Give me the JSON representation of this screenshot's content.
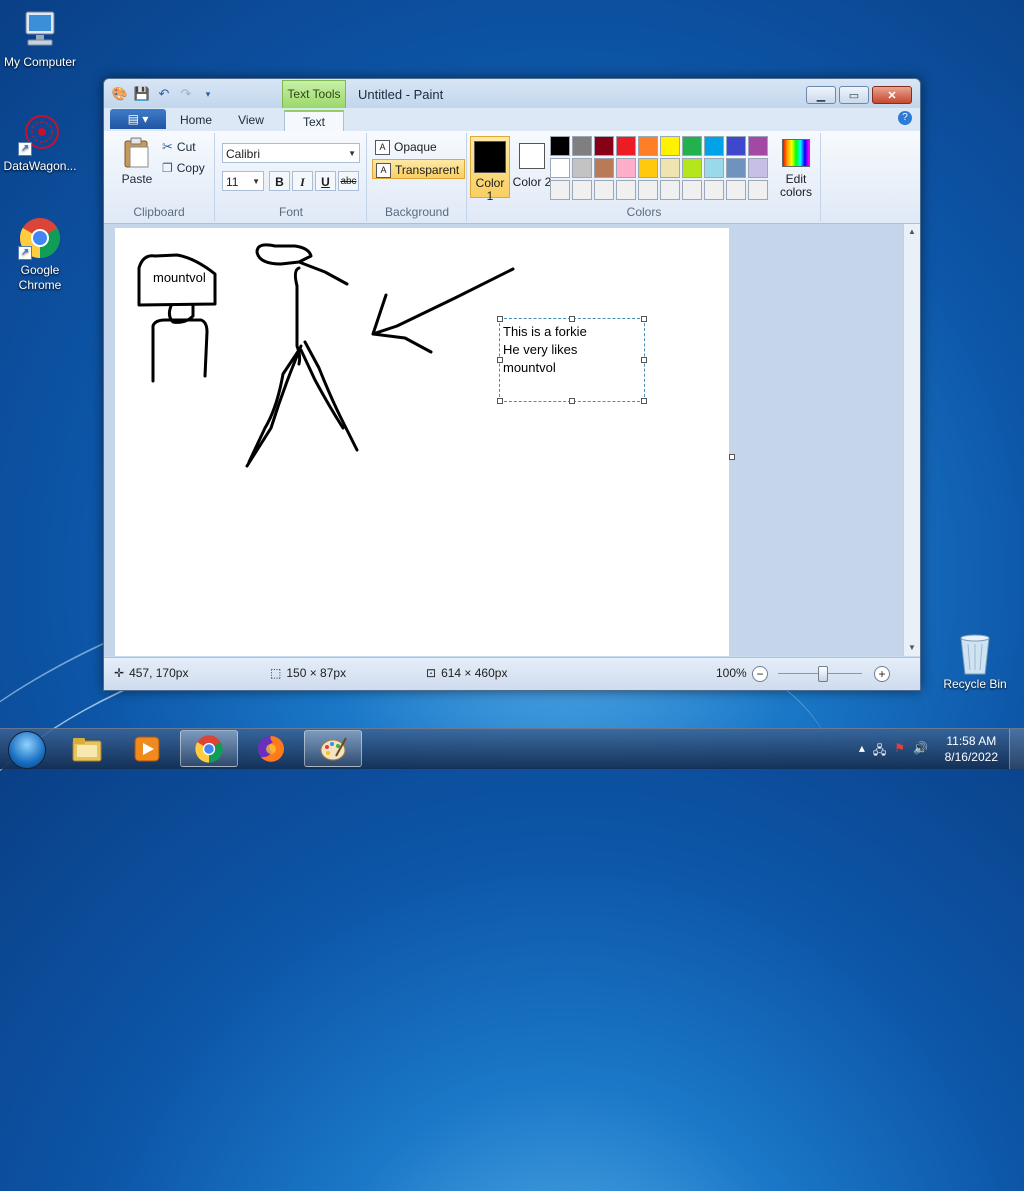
{
  "desktop": {
    "icons": [
      {
        "label": "My Computer"
      },
      {
        "label": "DataWagon..."
      },
      {
        "label": "Google Chrome"
      },
      {
        "label": "Recycle Bin"
      }
    ]
  },
  "window": {
    "title": "Untitled - Paint",
    "contextual_tab": "Text Tools",
    "tabs": [
      "Home",
      "View",
      "Text"
    ],
    "active_tab": "Text"
  },
  "ribbon": {
    "clipboard": {
      "paste": "Paste",
      "cut": "Cut",
      "copy": "Copy",
      "label": "Clipboard"
    },
    "font": {
      "family": "Calibri",
      "size": "11",
      "bold": "B",
      "italic": "I",
      "underline": "U",
      "strike": "abc",
      "label": "Font"
    },
    "background": {
      "opaque": "Opaque",
      "transparent": "Transparent",
      "label": "Background",
      "selected": "Transparent"
    },
    "colors": {
      "color1_label": "Color 1",
      "color1_value": "#000000",
      "color2_label": "Color 2",
      "color2_value": "#ffffff",
      "edit_label": "Edit colors",
      "label": "Colors",
      "palette": [
        "#000000",
        "#7f7f7f",
        "#880015",
        "#ed1c24",
        "#ff7f27",
        "#fff200",
        "#22b14c",
        "#00a2e8",
        "#3f48cc",
        "#a349a4",
        "#ffffff",
        "#c3c3c3",
        "#b97a57",
        "#ffaec9",
        "#ffc90e",
        "#efe4b0",
        "#b5e61d",
        "#99d9ea",
        "#7092be",
        "#c8bfe7",
        "#f0f0f0",
        "#f0f0f0",
        "#f0f0f0",
        "#f0f0f0",
        "#f0f0f0",
        "#f0f0f0",
        "#f0f0f0",
        "#f0f0f0",
        "#f0f0f0",
        "#f0f0f0"
      ]
    }
  },
  "canvas": {
    "drawn_text": "mountvol",
    "textbox_lines": [
      "This is a forkie",
      "He very likes",
      "mountvol"
    ]
  },
  "status": {
    "cursor": "457, 170px",
    "selection": "150 × 87px",
    "image_size": "614 × 460px",
    "zoom": "100%"
  },
  "taskbar": {
    "time": "11:58 AM",
    "date": "8/16/2022",
    "apps": [
      "Windows Explorer",
      "Windows Media Player",
      "Google Chrome",
      "Firefox",
      "Paint"
    ]
  }
}
